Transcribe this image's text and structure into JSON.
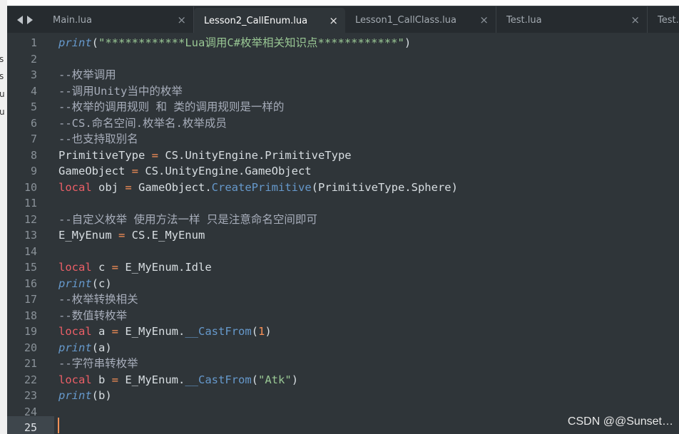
{
  "side_panel": {
    "items": [
      "s",
      "s",
      "u",
      "u"
    ]
  },
  "tabs": [
    {
      "label": "Main.lua",
      "active": false
    },
    {
      "label": "Lesson2_CallEnum.lua",
      "active": true
    },
    {
      "label": "Lesson1_CallClass.lua",
      "active": false
    },
    {
      "label": "Test.lua",
      "active": false
    },
    {
      "label": "Test.",
      "active": false
    }
  ],
  "tab_close_glyph": "×",
  "line_numbers": [
    "1",
    "2",
    "3",
    "4",
    "5",
    "6",
    "7",
    "8",
    "9",
    "10",
    "11",
    "12",
    "13",
    "14",
    "15",
    "16",
    "17",
    "18",
    "19",
    "20",
    "21",
    "22",
    "23",
    "24",
    "25"
  ],
  "code": {
    "l1_fn": "print",
    "l1_p1": "(",
    "l1_str": "\"************Lua调用C#枚举相关知识点************\"",
    "l1_p2": ")",
    "l3": "--枚举调用",
    "l4": "--调用Unity当中的枚举",
    "l5": "--枚举的调用规则 和 类的调用规则是一样的",
    "l6": "--CS.命名空间.枚举名.枚举成员",
    "l7": "--也支持取别名",
    "l8_a": "PrimitiveType",
    "l8_op": " = ",
    "l8_b": "CS.UnityEngine.PrimitiveType",
    "l9_a": "GameObject",
    "l9_op": " = ",
    "l9_b": "CS.UnityEngine.GameObject",
    "l10_kw": "local",
    "l10_a": " obj ",
    "l10_op": "=",
    "l10_b": " GameObject.",
    "l10_m": "CreatePrimitive",
    "l10_c": "(PrimitiveType.Sphere)",
    "l12": "--自定义枚举 使用方法一样 只是注意命名空间即可",
    "l13_a": "E_MyEnum",
    "l13_op": " = ",
    "l13_b": "CS.E_MyEnum",
    "l15_kw": "local",
    "l15_a": " c ",
    "l15_op": "=",
    "l15_b": " E_MyEnum.Idle",
    "l16_fn": "print",
    "l16_b": "(c)",
    "l17": "--枚举转换相关",
    "l18": "--数值转枚举",
    "l19_kw": "local",
    "l19_a": " a ",
    "l19_op": "=",
    "l19_b": " E_MyEnum.",
    "l19_m": "__CastFrom",
    "l19_p1": "(",
    "l19_num": "1",
    "l19_p2": ")",
    "l20_fn": "print",
    "l20_b": "(a)",
    "l21": "--字符串转枚举",
    "l22_kw": "local",
    "l22_a": " b ",
    "l22_op": "=",
    "l22_b": " E_MyEnum.",
    "l22_m": "__CastFrom",
    "l22_p1": "(",
    "l22_str": "\"Atk\"",
    "l22_p2": ")",
    "l23_fn": "print",
    "l23_b": "(b)"
  },
  "watermark": "CSDN @@Sunset…",
  "colors": {
    "editor_bg": "#2f3539",
    "keyword": "#ec5f67",
    "function": "#6699cc",
    "string": "#99c794",
    "number": "#f99157",
    "comment": "#a7adba"
  }
}
